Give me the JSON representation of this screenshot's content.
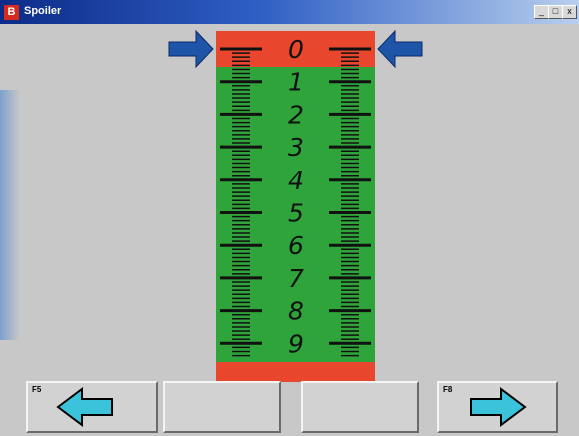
{
  "window": {
    "title": "Spoiler",
    "app_icon": "B",
    "controls": {
      "minimize": "_",
      "maximize": "□",
      "close": "x"
    }
  },
  "scale": {
    "numbers": [
      "0",
      "1",
      "2",
      "3",
      "4",
      "5",
      "6",
      "7",
      "8",
      "9"
    ],
    "current_value": 0,
    "zones": {
      "red": "#e8472e",
      "green": "#2fa43a"
    }
  },
  "buttons": {
    "prev": {
      "fkey": "F5",
      "icon": "arrow-left-icon"
    },
    "blank1": {},
    "blank2": {},
    "next": {
      "fkey": "F8",
      "icon": "arrow-right-icon"
    }
  },
  "colors": {
    "pointer": "#1f55a8",
    "nav_arrow": "#3cc3dc"
  }
}
